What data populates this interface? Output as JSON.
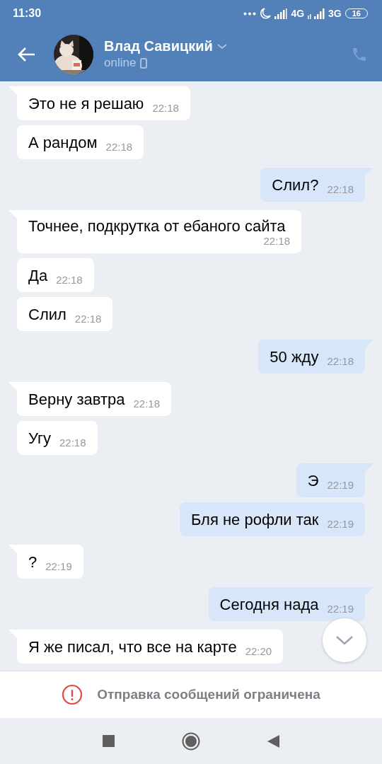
{
  "status_bar": {
    "time": "11:30",
    "network_1": "4G",
    "network_2": "3G",
    "battery": "16"
  },
  "header": {
    "name": "Влад Савицкий",
    "status": "online"
  },
  "messages": [
    {
      "kind": "incoming",
      "tail": true,
      "text": "Это не я решаю",
      "time": "22:18"
    },
    {
      "kind": "incoming",
      "tail": false,
      "text": "А рандом",
      "time": "22:18"
    },
    {
      "kind": "outgoing",
      "tail": true,
      "text": "Слил?",
      "time": "22:18"
    },
    {
      "kind": "incoming",
      "tail": true,
      "text": "Точнее, подкрутка от ебаного сайта",
      "time": "22:18"
    },
    {
      "kind": "incoming",
      "tail": false,
      "text": "Да",
      "time": "22:18"
    },
    {
      "kind": "incoming",
      "tail": false,
      "text": "Слил",
      "time": "22:18"
    },
    {
      "kind": "outgoing",
      "tail": true,
      "text": "50 жду",
      "time": "22:18"
    },
    {
      "kind": "incoming",
      "tail": true,
      "text": "Верну завтра",
      "time": "22:18"
    },
    {
      "kind": "incoming",
      "tail": false,
      "text": "Угу",
      "time": "22:18"
    },
    {
      "kind": "outgoing",
      "tail": true,
      "text": "Э",
      "time": "22:19"
    },
    {
      "kind": "outgoing",
      "tail": false,
      "text": "Бля не рофли так",
      "time": "22:19"
    },
    {
      "kind": "incoming",
      "tail": true,
      "text": "?",
      "time": "22:19"
    },
    {
      "kind": "outgoing",
      "tail": true,
      "text": "Сегодня нада",
      "time": "22:19"
    },
    {
      "kind": "incoming",
      "tail": true,
      "text": "Я же писал, что все на карте",
      "time": "22:20"
    }
  ],
  "notice": {
    "text": "Отправка сообщений ограничена"
  }
}
